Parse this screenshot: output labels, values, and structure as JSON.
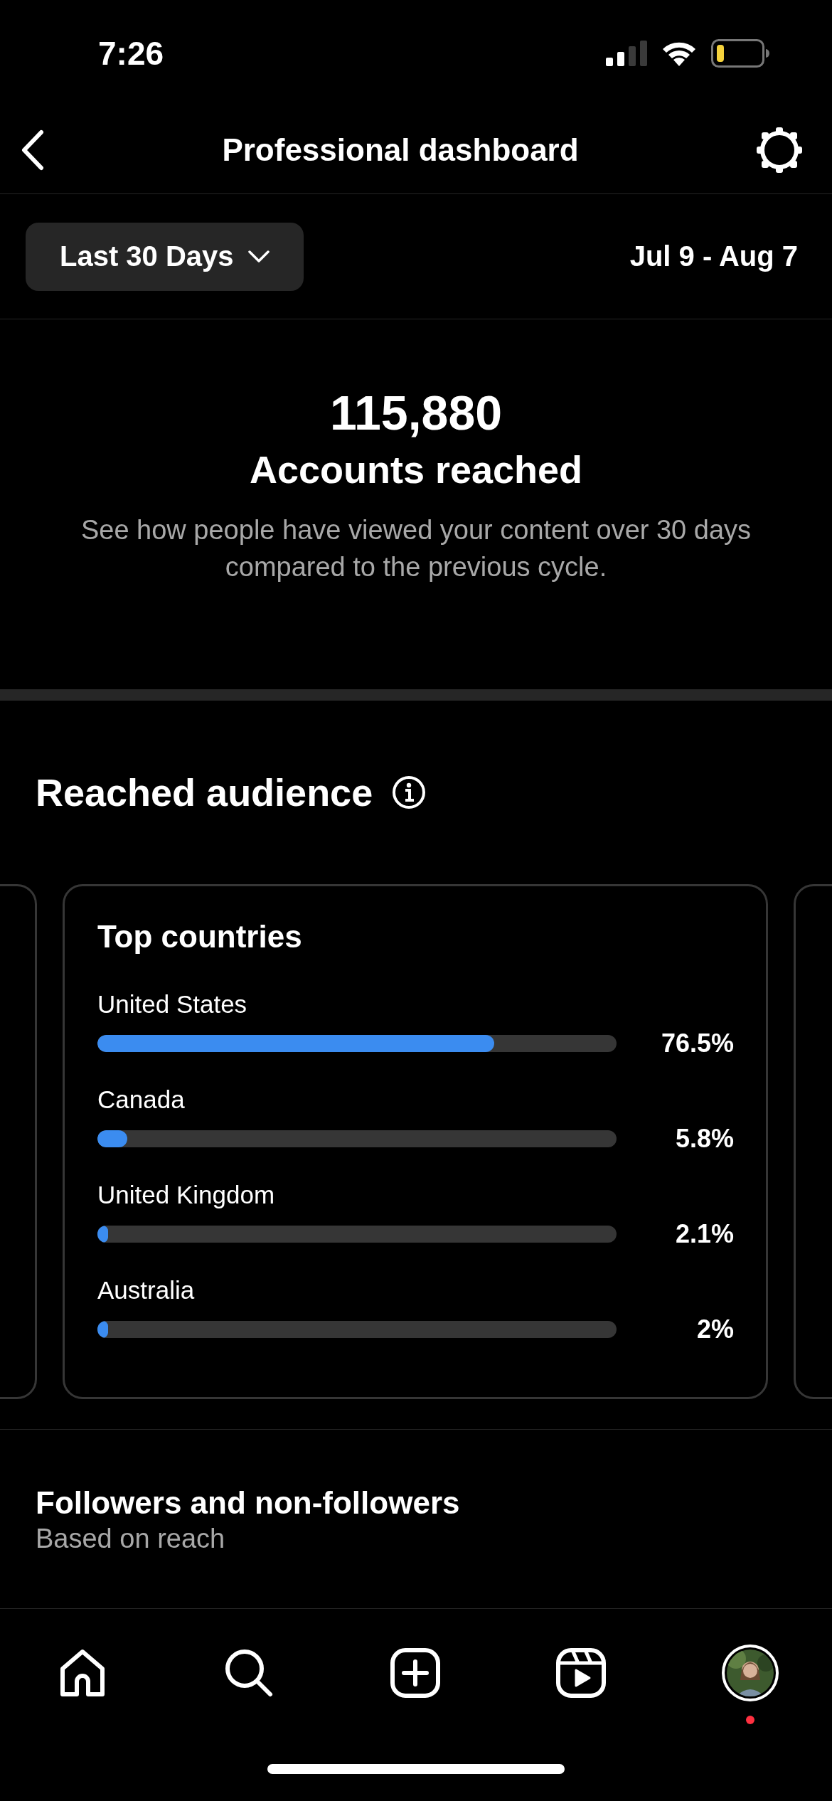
{
  "status_bar": {
    "time": "7:26"
  },
  "header": {
    "title": "Professional dashboard"
  },
  "filter": {
    "range": "Last 30 Days",
    "dates": "Jul 9 - Aug 7"
  },
  "summary": {
    "value": "115,880",
    "label": "Accounts reached",
    "description": "See how people have viewed your content over 30 days compared to the previous cycle."
  },
  "audience": {
    "title": "Reached audience",
    "card": {
      "title": "Top countries",
      "rows": [
        {
          "name": "United States",
          "level": 0.765,
          "reading": "76.5%"
        },
        {
          "name": "Canada",
          "level": 0.058,
          "reading": "5.8%"
        },
        {
          "name": "United Kingdom",
          "level": 0.021,
          "reading": "2.1%"
        },
        {
          "name": "Australia",
          "level": 0.02,
          "reading": "2%"
        }
      ]
    }
  },
  "followers": {
    "title": "Followers and non-followers",
    "subtitle": "Based on reach"
  },
  "tab_bar": {
    "items": [
      {
        "kind": "home"
      },
      {
        "kind": "search"
      },
      {
        "kind": "create"
      },
      {
        "kind": "reels"
      },
      {
        "kind": "profile",
        "notification": true
      }
    ]
  }
}
